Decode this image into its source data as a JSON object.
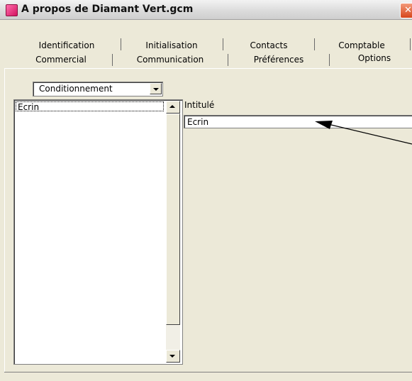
{
  "window": {
    "title": "A propos de Diamant Vert.gcm",
    "close_glyph": "✕"
  },
  "tabs": {
    "row1": [
      {
        "label": "Identification"
      },
      {
        "label": "Initialisation"
      },
      {
        "label": "Contacts"
      },
      {
        "label": "Comptable"
      }
    ],
    "row2": [
      {
        "label": "Commercial"
      },
      {
        "label": "Communication"
      },
      {
        "label": "Préférences"
      },
      {
        "label": "Options",
        "active": true
      }
    ]
  },
  "options": {
    "category_select": {
      "value": "Conditionnement"
    },
    "list": {
      "items": [
        {
          "label": "Ecrin",
          "selected": true
        }
      ]
    },
    "intitule": {
      "label": "Intitulé",
      "value": "Ecrin"
    }
  },
  "icons": {
    "app": "diamond-app-icon",
    "close": "close-icon",
    "dropdown": "chevron-down-icon",
    "scroll_up": "arrow-up-icon",
    "scroll_down": "arrow-down-icon"
  },
  "colors": {
    "window_bg": "#ece9d8",
    "close_button": "#d6451b",
    "app_icon": "#d3125f"
  }
}
